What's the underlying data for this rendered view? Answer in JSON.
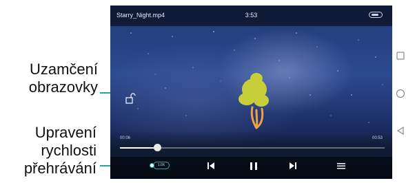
{
  "annotations": {
    "screen_lock_line1": "Uzamčení",
    "screen_lock_line2": "obrazovky",
    "speed_line1": "Upravení",
    "speed_line2": "rychlosti",
    "speed_line3": "přehrávání"
  },
  "player": {
    "filename": "Starry_Night.mp4",
    "clock": "3:53",
    "elapsed": "00:06",
    "total": "00:53",
    "progress_fraction": 0.14,
    "speed_label": "1.0X"
  },
  "icons": {
    "lock": "lock-open-icon",
    "previous": "skip-previous-icon",
    "pause": "pause-icon",
    "next": "skip-next-icon",
    "playlist": "playlist-icon",
    "battery": "battery-icon",
    "nav_recent": "nav-recent-square-icon",
    "nav_home": "nav-home-circle-icon",
    "nav_back": "nav-back-triangle-icon"
  },
  "colors": {
    "accent": "#1aa7a0",
    "sky": "#2c4a8f",
    "tree_leaves": "#c6cf3a",
    "trunk_glow": "#f0a046"
  }
}
